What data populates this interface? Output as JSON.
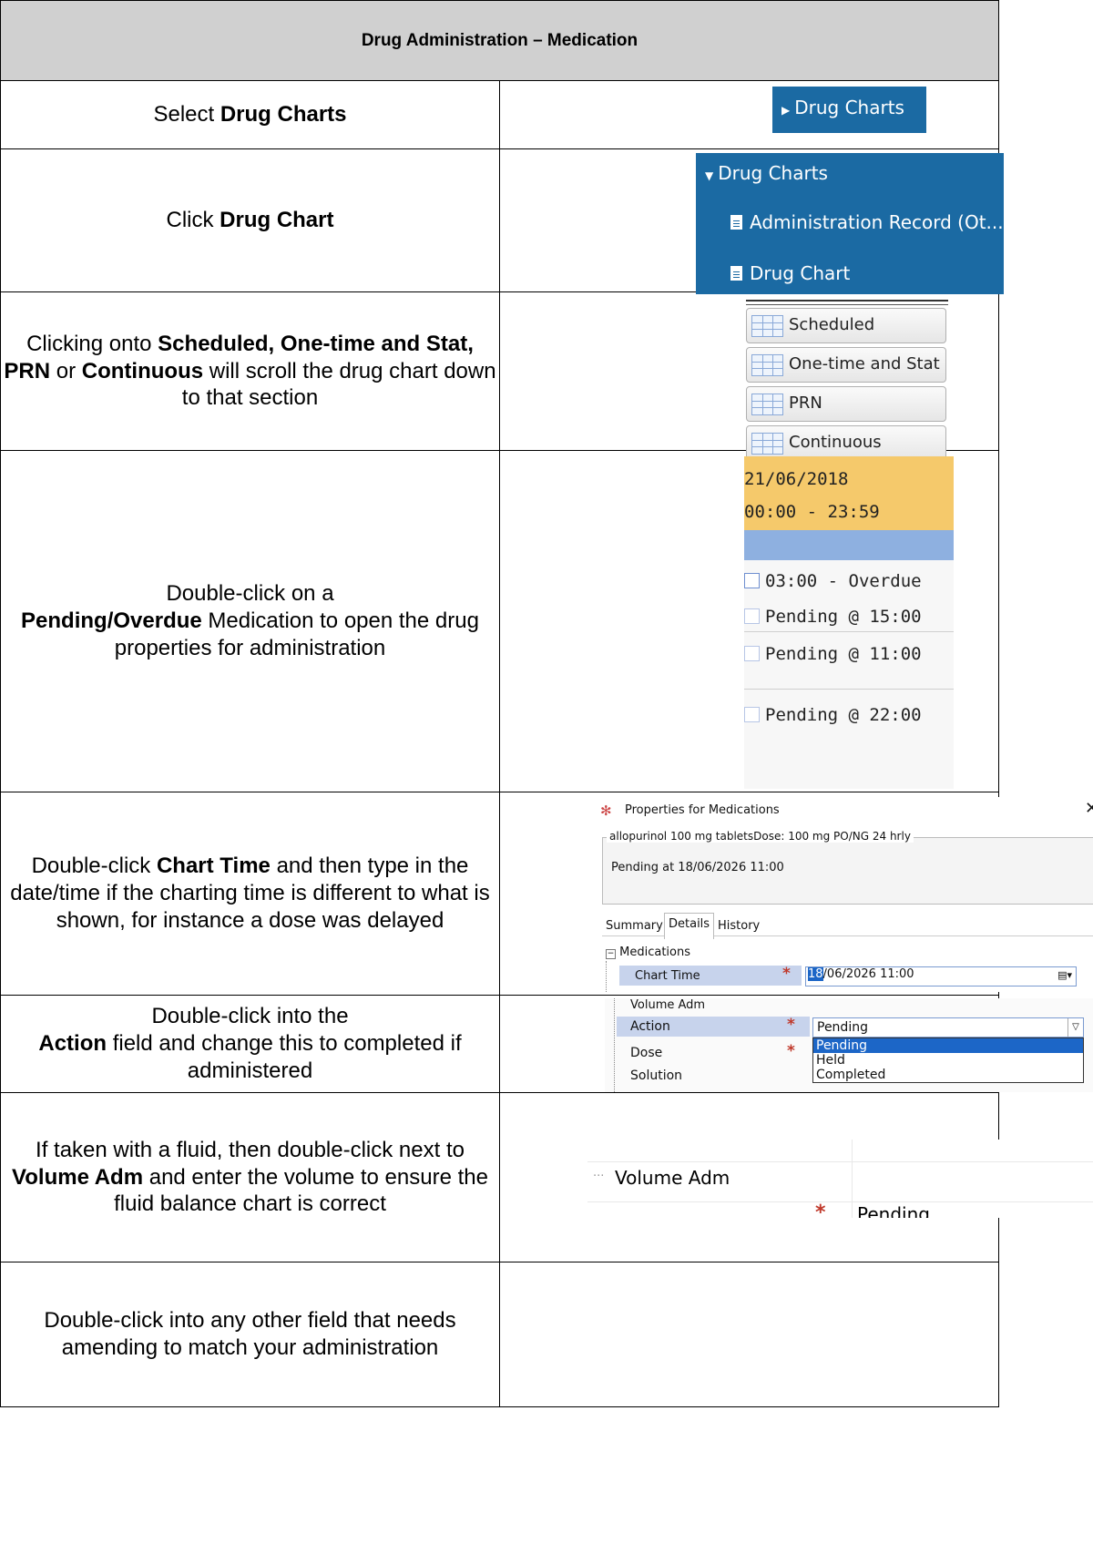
{
  "title": "Drug Administration – Medication",
  "steps": [
    {
      "pre": "Select ",
      "bold": "Drug Charts",
      "post": ""
    },
    {
      "pre": "Click ",
      "bold": "Drug Chart",
      "post": ""
    },
    {
      "pre": "Clicking onto ",
      "bold": "Scheduled, One-time and Stat, PRN",
      "mid": " or ",
      "bold2": "Continuous",
      "post": " will scroll the drug chart down to that section"
    },
    {
      "pre": "Double-click on a ",
      "bold": "Pending/Overdue",
      "post": " Medication to open the drug properties for administration"
    },
    {
      "pre": "Double-click ",
      "bold": "Chart Time",
      "post": " and then type in the date/time if the charting time is different to what is shown, for instance a dose was delayed"
    },
    {
      "pre": "Double-click into the ",
      "bold": "Action",
      "post": " field and change this to completed if administered"
    },
    {
      "pre": "If taken with a fluid, then double-click next to ",
      "bold": "Volume Adm",
      "post": " and enter the volume to ensure the fluid balance chart is correct"
    },
    {
      "pre": "Double-click into any other field that needs amending to match your administration",
      "bold": "",
      "post": ""
    }
  ],
  "shot1": {
    "label": "Drug Charts",
    "icon": "triangle-right-icon"
  },
  "shot2": {
    "parent": "Drug Charts",
    "items": [
      "Administration Record (Ot...",
      "Drug Chart"
    ],
    "icon": "document-icon"
  },
  "shot3": {
    "buttons": [
      "Scheduled",
      "One-time and Stat",
      "PRN",
      "Continuous"
    ],
    "icon": "grid-icon"
  },
  "shot4": {
    "date": "21/06/2018",
    "time_range": "00:00 - 23:59",
    "entries": [
      "03:00 - Overdue",
      "Pending @ 15:00",
      "Pending @ 11:00",
      "Pending @ 22:00"
    ],
    "header_color": "#f5c96b",
    "band_color": "#8eb0e0"
  },
  "shot5": {
    "window_title": "Properties for Medications",
    "drug": "allopurinol 100 mg tabletsDose: 100 mg PO/NG 24 hrly",
    "pending": "Pending at 18/06/2026 11:00",
    "tabs": [
      "Summary",
      "Details",
      "History"
    ],
    "group": "Medications",
    "field": "Chart Time",
    "value_highlight": "18",
    "value_rest": "/06/2026  11:00"
  },
  "shot6": {
    "rows": [
      "Volume Adm",
      "Action",
      "Dose",
      "Solution"
    ],
    "action_value": "Pending",
    "options": [
      "Pending",
      "Held",
      "Completed"
    ],
    "selected": "Pending"
  },
  "shot7": {
    "row1": "Volume Adm",
    "row2_value": "Pending"
  }
}
